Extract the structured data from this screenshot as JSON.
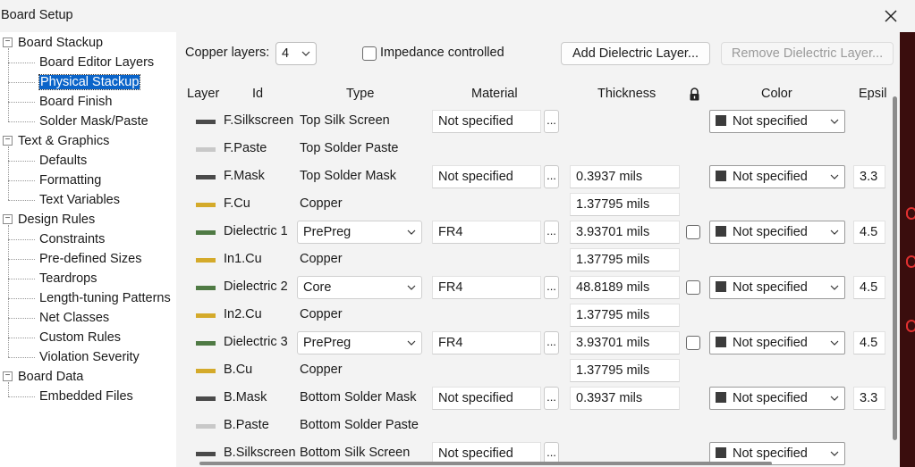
{
  "window": {
    "title": "Board Setup",
    "close_label": "✕"
  },
  "sidebar": {
    "groups": [
      {
        "label": "Board Stackup",
        "children": [
          "Board Editor Layers",
          "Physical Stackup",
          "Board Finish",
          "Solder Mask/Paste"
        ]
      },
      {
        "label": "Text & Graphics",
        "children": [
          "Defaults",
          "Formatting",
          "Text Variables"
        ]
      },
      {
        "label": "Design Rules",
        "children": [
          "Constraints",
          "Pre-defined Sizes",
          "Teardrops",
          "Length-tuning Patterns",
          "Net Classes",
          "Custom Rules",
          "Violation Severity"
        ]
      },
      {
        "label": "Board Data",
        "children": [
          "Embedded Files"
        ]
      }
    ],
    "selected": "Physical Stackup"
  },
  "toolbar": {
    "copper_layers_label": "Copper layers:",
    "copper_layers_value": "4",
    "impedance_label": "Impedance controlled",
    "impedance_checked": false,
    "add_dielectric_label": "Add Dielectric Layer...",
    "remove_dielectric_label": "Remove Dielectric Layer..."
  },
  "table": {
    "headers": {
      "layer": "Layer",
      "id": "Id",
      "type": "Type",
      "material": "Material",
      "thickness": "Thickness",
      "color": "Color",
      "epsilon": "Epsil"
    },
    "rows": [
      {
        "id": "F.Silkscreen",
        "swatch": "#4a4a4a",
        "type": "Top Silk Screen",
        "type_dropdown": false,
        "material": "Not specified",
        "thickness": "",
        "lock": false,
        "color": "Not specified",
        "epsilon": ""
      },
      {
        "id": "F.Paste",
        "swatch": "#c8c8c8",
        "type": "Top Solder Paste",
        "type_dropdown": false,
        "material": "",
        "thickness": "",
        "lock": false,
        "color": "",
        "epsilon": ""
      },
      {
        "id": "F.Mask",
        "swatch": "#4a4a4a",
        "type": "Top Solder Mask",
        "type_dropdown": false,
        "material": "Not specified",
        "thickness": "0.3937 mils",
        "lock": false,
        "color": "Not specified",
        "epsilon": "3.3"
      },
      {
        "id": "F.Cu",
        "swatch": "#d4aa2a",
        "type": "Copper",
        "type_dropdown": false,
        "material": "",
        "thickness": "1.37795 mils",
        "lock": false,
        "color": "",
        "epsilon": ""
      },
      {
        "id": "Dielectric 1",
        "swatch": "#4f7a44",
        "type": "PrePreg",
        "type_dropdown": true,
        "material": "FR4",
        "thickness": "3.93701 mils",
        "lock": true,
        "color": "Not specified",
        "epsilon": "4.5"
      },
      {
        "id": "In1.Cu",
        "swatch": "#d4aa2a",
        "type": "Copper",
        "type_dropdown": false,
        "material": "",
        "thickness": "1.37795 mils",
        "lock": false,
        "color": "",
        "epsilon": ""
      },
      {
        "id": "Dielectric 2",
        "swatch": "#4f7a44",
        "type": "Core",
        "type_dropdown": true,
        "material": "FR4",
        "thickness": "48.8189 mils",
        "lock": true,
        "color": "Not specified",
        "epsilon": "4.5"
      },
      {
        "id": "In2.Cu",
        "swatch": "#d4aa2a",
        "type": "Copper",
        "type_dropdown": false,
        "material": "",
        "thickness": "1.37795 mils",
        "lock": false,
        "color": "",
        "epsilon": ""
      },
      {
        "id": "Dielectric 3",
        "swatch": "#4f7a44",
        "type": "PrePreg",
        "type_dropdown": true,
        "material": "FR4",
        "thickness": "3.93701 mils",
        "lock": true,
        "color": "Not specified",
        "epsilon": "4.5"
      },
      {
        "id": "B.Cu",
        "swatch": "#d4aa2a",
        "type": "Copper",
        "type_dropdown": false,
        "material": "",
        "thickness": "1.37795 mils",
        "lock": false,
        "color": "",
        "epsilon": ""
      },
      {
        "id": "B.Mask",
        "swatch": "#4a4a4a",
        "type": "Bottom Solder Mask",
        "type_dropdown": false,
        "material": "Not specified",
        "thickness": "0.3937 mils",
        "lock": false,
        "color": "Not specified",
        "epsilon": "3.3"
      },
      {
        "id": "B.Paste",
        "swatch": "#c8c8c8",
        "type": "Bottom Solder Paste",
        "type_dropdown": false,
        "material": "",
        "thickness": "",
        "lock": false,
        "color": "",
        "epsilon": ""
      },
      {
        "id": "B.Silkscreen",
        "swatch": "#4a4a4a",
        "type": "Bottom Silk Screen",
        "type_dropdown": false,
        "material": "Not specified",
        "thickness": "",
        "lock": false,
        "color": "Not specified",
        "epsilon": ""
      }
    ],
    "material_button_label": "...",
    "lock_icon": "padlock-icon"
  }
}
